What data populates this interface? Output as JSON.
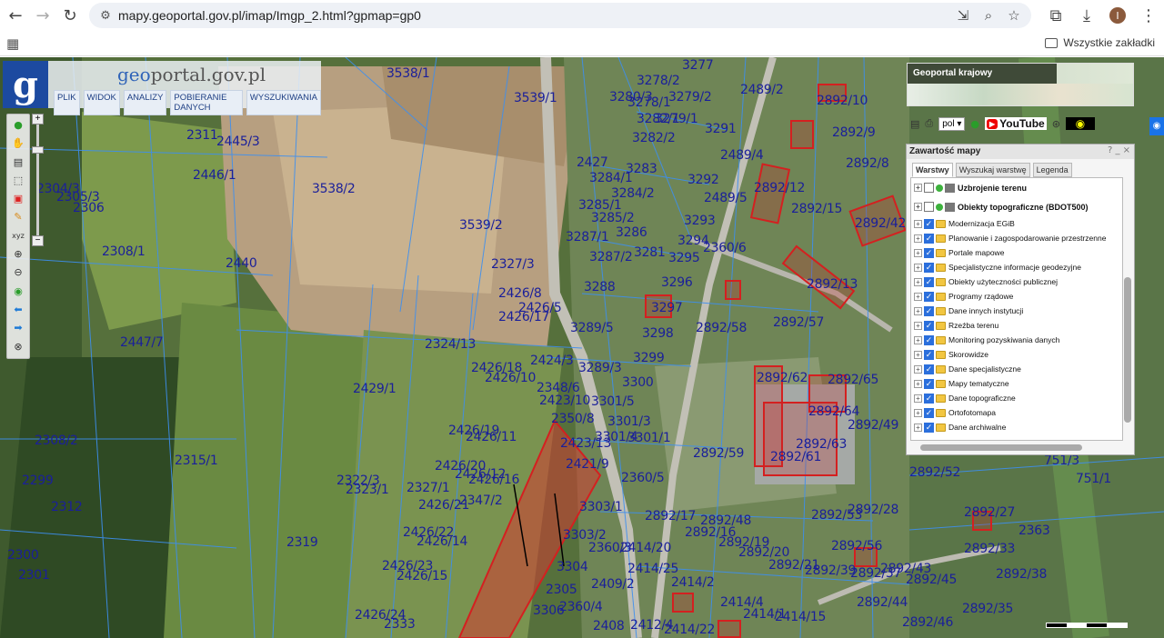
{
  "browser": {
    "url": "mapy.geoportal.gov.pl/imap/Imgp_2.html?gpmap=gp0",
    "bookmarks_all": "Wszystkie zakładki",
    "avatar_letter": "I"
  },
  "logo": {
    "prefix": "geo",
    "rest": "portal.gov.pl"
  },
  "menu": [
    "PLIK",
    "WIDOK",
    "ANALIZY",
    "POBIERANIE DANYCH",
    "WYSZUKIWANIA"
  ],
  "krajowy": {
    "title": "Geoportal krajowy"
  },
  "icon_bar": {
    "language": "pol",
    "youtube": "YouTube"
  },
  "panel": {
    "title": "Zawartość mapy",
    "controls": "? _ ×",
    "tabs": [
      "Warstwy",
      "Wyszukaj warstwę",
      "Legenda"
    ],
    "layers": [
      {
        "label": "Uzbrojenie terenu",
        "checked": false,
        "kind": "service"
      },
      {
        "label": "Obiekty topograficzne (BDOT500)",
        "checked": false,
        "kind": "service"
      },
      {
        "label": "Modernizacja EGiB",
        "checked": true,
        "kind": "folder"
      },
      {
        "label": "Planowanie i zagospodarowanie przestrzenne",
        "checked": true,
        "kind": "folder"
      },
      {
        "label": "Portale mapowe",
        "checked": true,
        "kind": "folder"
      },
      {
        "label": "Specjalistyczne informacje geodezyjne",
        "checked": true,
        "kind": "folder"
      },
      {
        "label": "Obiekty użyteczności publicznej",
        "checked": true,
        "kind": "folder"
      },
      {
        "label": "Programy rządowe",
        "checked": true,
        "kind": "folder"
      },
      {
        "label": "Dane innych instytucji",
        "checked": true,
        "kind": "folder"
      },
      {
        "label": "Rzeźba terenu",
        "checked": true,
        "kind": "folder"
      },
      {
        "label": "Monitoring pozyskiwania danych",
        "checked": true,
        "kind": "folder"
      },
      {
        "label": "Skorowidze",
        "checked": true,
        "kind": "folder"
      },
      {
        "label": "Dane specjalistyczne",
        "checked": true,
        "kind": "folder"
      },
      {
        "label": "Mapy tematyczne",
        "checked": true,
        "kind": "folder"
      },
      {
        "label": "Dane topograficzne",
        "checked": true,
        "kind": "folder"
      },
      {
        "label": "Ortofotomapa",
        "checked": true,
        "kind": "folder"
      },
      {
        "label": "Dane archiwalne",
        "checked": true,
        "kind": "folder"
      }
    ]
  },
  "parcels": [
    "3538/1",
    "3539/1",
    "3538/2",
    "3539/2",
    "2311",
    "2445/3",
    "2446/1",
    "2308/1",
    "2440",
    "2447/7",
    "2429/1",
    "2315/1",
    "2319",
    "2301",
    "2300",
    "2299",
    "2312",
    "2327/3",
    "2426/8",
    "2426/5",
    "2426/17",
    "2324/13",
    "2426/18",
    "2426/10",
    "2426/19",
    "2426/11",
    "2426/20",
    "2426/12",
    "2426/16",
    "2327/1",
    "2322/3",
    "2323/1",
    "2426/21",
    "2347/2",
    "2426/22",
    "2426/14",
    "2426/23",
    "2426/15",
    "2426/24",
    "2333",
    "2424/3",
    "2348/6",
    "2423/10",
    "2350/8",
    "2423/13",
    "2421/9",
    "2360/5",
    "3303/1",
    "3303/2",
    "2360/3",
    "2414/20",
    "2409/2",
    "2414/25",
    "2414/2",
    "2414/4",
    "2414/1",
    "2414/15",
    "2408",
    "2412/4",
    "2414/22",
    "2360/4",
    "3306",
    "3304",
    "2305",
    "3277",
    "3278/2",
    "3279/2",
    "3280/3",
    "3278/1",
    "3282/1",
    "3279/1",
    "3282/2",
    "3291",
    "3283",
    "2427",
    "3284/1",
    "3284/2",
    "3285/1",
    "3285/2",
    "3286",
    "3287/1",
    "3287/2",
    "3281",
    "3294",
    "3295",
    "3293",
    "3292",
    "3288",
    "3296",
    "3297",
    "3298",
    "3299",
    "3289/3",
    "3289/5",
    "3300",
    "3301/5",
    "3301/3",
    "3301/4",
    "3301/1",
    "2360/6",
    "2489/2",
    "2489/4",
    "2489/5",
    "2892/10",
    "2892/9",
    "2892/8",
    "2892/12",
    "2892/15",
    "2892/42",
    "2892/13",
    "2892/57",
    "2892/58",
    "2892/62",
    "2892/65",
    "2892/64",
    "2892/63",
    "2892/61",
    "2892/59",
    "2892/49",
    "2892/52",
    "2892/53",
    "2892/28",
    "2892/17",
    "2892/48",
    "2892/16",
    "2892/19",
    "2892/20",
    "2892/56",
    "2892/21",
    "2892/43",
    "2892/39",
    "2892/37",
    "2892/45",
    "2892/44",
    "2892/46",
    "2892/27",
    "2892/33",
    "2892/38",
    "2892/35",
    "2363",
    "751/3",
    "751/1",
    "2304/3",
    "2306",
    "2308/2",
    "2305/3"
  ]
}
